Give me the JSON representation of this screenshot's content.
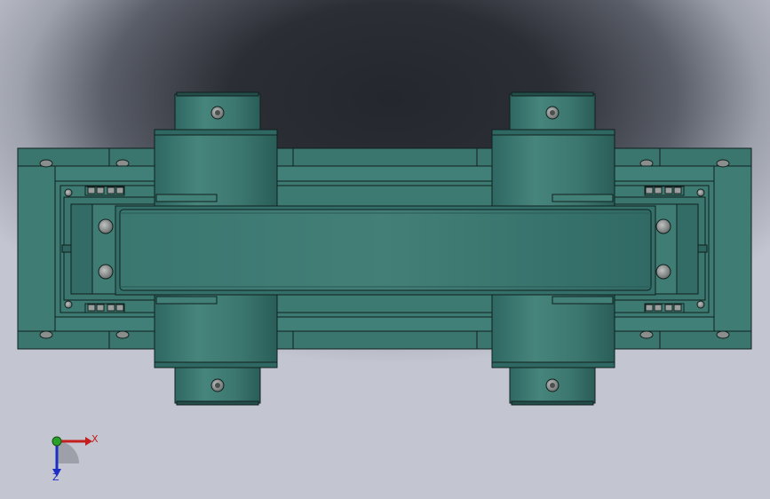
{
  "colors": {
    "background_top": "#24272d",
    "background_bottom": "#c3c6d0",
    "part_fill": "#3f7c74",
    "part_fill_dark": "#2f6560",
    "part_fill_light": "#4b8a80",
    "edge": "#10201e",
    "bolt": "#8a8f8e",
    "axis_x": "#c41e1e",
    "axis_y": "#2aa02a",
    "axis_z": "#1e2ec4"
  },
  "triad": {
    "x_label": "X",
    "z_label": "Z"
  }
}
